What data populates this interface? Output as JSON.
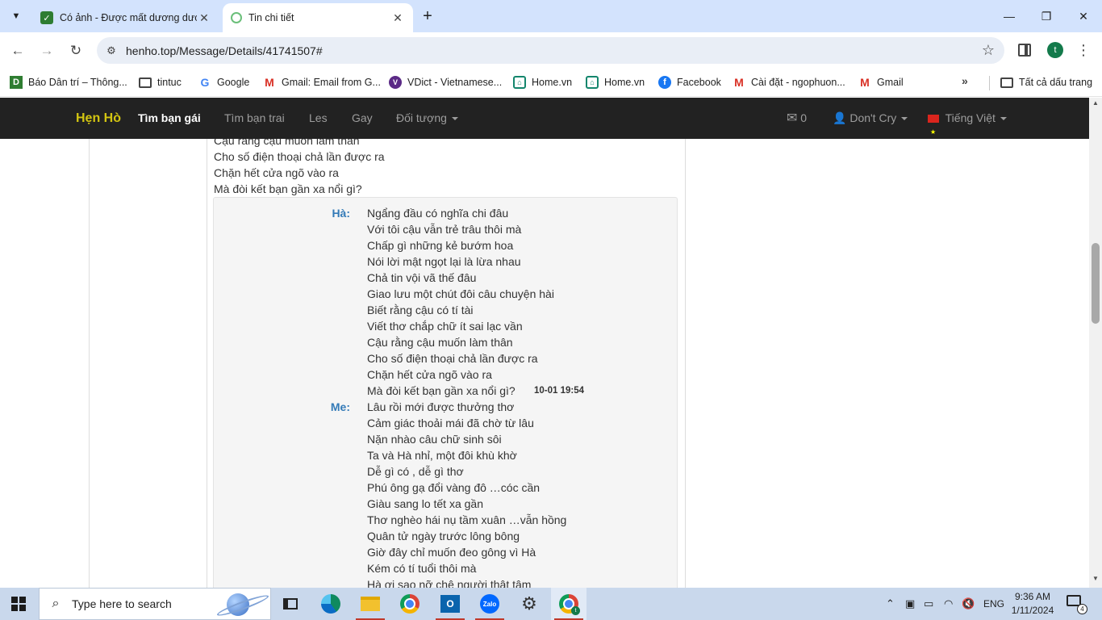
{
  "browser": {
    "tabs": [
      {
        "title": "Có ảnh - Được mất dương dươ",
        "active": false
      },
      {
        "title": "Tin chi tiết",
        "active": true
      }
    ],
    "url": "henho.top/Message/Details/41741507#",
    "profile_initial": "t",
    "bookmarks": [
      {
        "label": "Báo Dân trí – Thông...",
        "icon": "dantri-icon"
      },
      {
        "label": "tintuc",
        "icon": "folder-icon"
      },
      {
        "label": "Google",
        "icon": "google-icon"
      },
      {
        "label": "Gmail: Email from G...",
        "icon": "gmail-icon"
      },
      {
        "label": "VDict - Vietnamese...",
        "icon": "vdict-icon"
      },
      {
        "label": "Home.vn",
        "icon": "homevn-icon"
      },
      {
        "label": "Home.vn",
        "icon": "homevn-icon"
      },
      {
        "label": "Facebook",
        "icon": "facebook-icon"
      },
      {
        "label": "Cài đặt - ngophuon...",
        "icon": "gmail-icon"
      },
      {
        "label": "Gmail",
        "icon": "gmail-icon"
      }
    ],
    "all_bookmarks_label": "Tất cả dấu trang"
  },
  "site_nav": {
    "brand": "Hẹn Hò",
    "items": [
      "Tìm bạn gái",
      "Tìm bạn trai",
      "Les",
      "Gay",
      "Đối tượng"
    ],
    "message_count": "0",
    "user_name": "Don't Cry",
    "language": "Tiếng Việt"
  },
  "message": {
    "top_lines": [
      "Cậu rằng cậu muốn làm thân",
      "Cho số điện thoại chả lần được ra",
      "Chặn hết cửa ngõ vào ra",
      "Mà đòi kết bạn gần xa nổi gì?"
    ],
    "quote": [
      {
        "speaker": "Hà:",
        "lines": [
          "Ngẩng đầu có nghĩa chi đâu",
          "Với tôi cậu vẫn trẻ trâu thôi mà",
          "Chấp gì những kẻ bướm hoa",
          "Nói lời mật ngọt lại là lừa nhau",
          "Chả tin vội vã thế đâu",
          "Giao lưu một chút đôi câu chuyện hài",
          "Biết rằng cậu có tí tài",
          "Viết thơ chắp chữ ít sai lạc vần",
          "Cậu rằng cậu muốn làm thân",
          "Cho số điện thoại chả lần được ra",
          "Chặn hết cửa ngõ vào ra",
          "Mà đòi kết bạn gần xa nổi gì?"
        ],
        "time": "10-01 19:54"
      },
      {
        "speaker": "Me:",
        "lines": [
          "Lâu rồi mới được thưởng thơ",
          "Cảm giác thoải mái đã chờ từ lâu",
          "Nặn nhào câu chữ sinh sôi",
          "Ta và Hà nhỉ, một đôi khù khờ",
          "Dễ gì có , dễ gì thơ",
          "Phú ông gạ đổi vàng đô …cóc cần",
          "Giàu sang lo tết xa gần",
          "Thơ nghèo hái nụ tầm xuân …vẫn hồng",
          "Quân tử ngày trước lông bông",
          "Giờ đây chỉ muốn đeo gông vì Hà",
          "Kém có tí tuổi thôi mà",
          "Hà ơi sao nỡ chê người thật tâm"
        ]
      }
    ]
  },
  "taskbar": {
    "search_placeholder": "Type here to search",
    "language": "ENG",
    "time": "9:36 AM",
    "date": "1/11/2024",
    "notification_count": "4"
  }
}
